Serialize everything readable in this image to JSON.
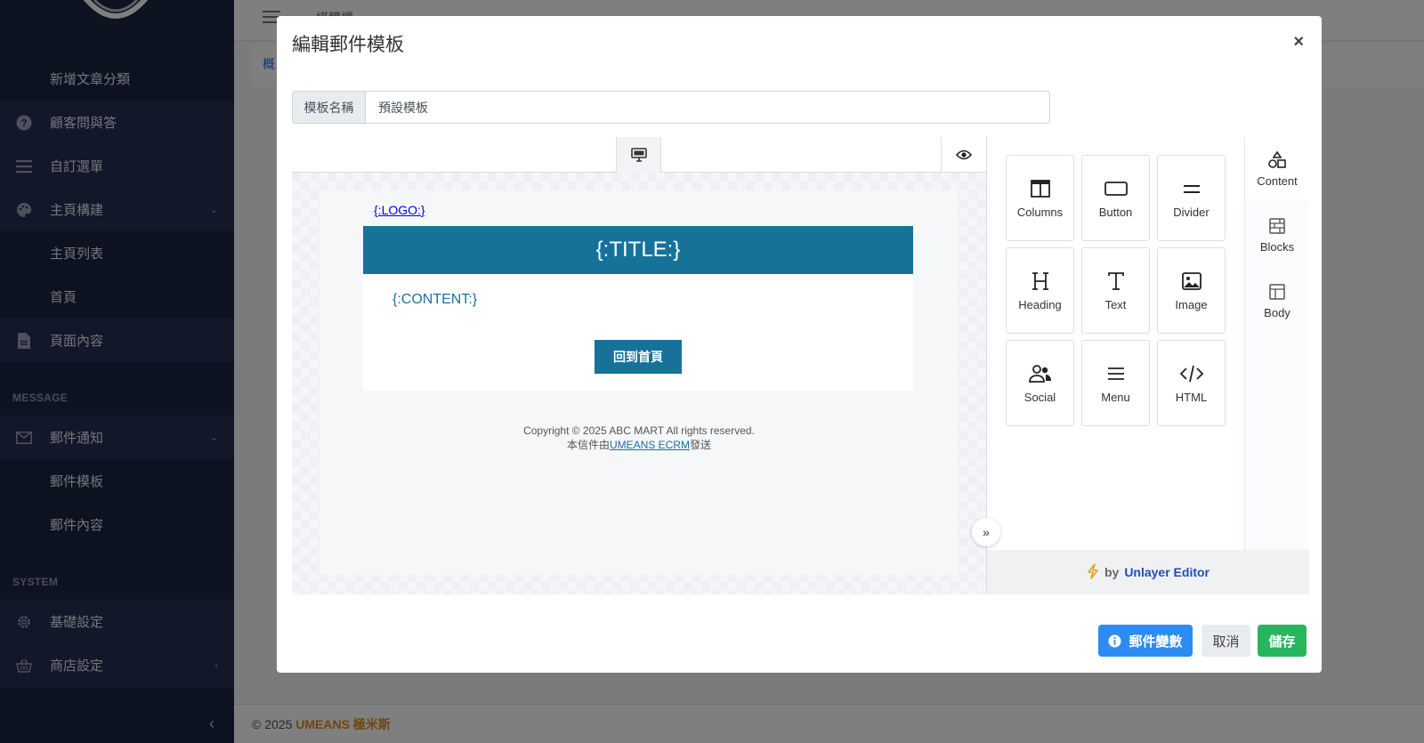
{
  "sidebar": {
    "items": [
      {
        "label": "新增文章分類",
        "icon": "",
        "type": "sub"
      },
      {
        "label": "顧客問與答",
        "icon": "question-circle-icon"
      },
      {
        "label": "自訂選單",
        "icon": "list-icon"
      },
      {
        "label": "主頁構建",
        "icon": "palette-icon",
        "chevron": "⌄"
      },
      {
        "label": "主頁列表",
        "icon": "",
        "type": "sub"
      },
      {
        "label": "首頁",
        "icon": "",
        "type": "sub"
      },
      {
        "label": "頁面內容",
        "icon": "file-icon"
      },
      {
        "label": "郵件通知",
        "icon": "envelope-icon",
        "chevron": "⌄"
      },
      {
        "label": "郵件模板",
        "icon": "",
        "type": "sub"
      },
      {
        "label": "郵件內容",
        "icon": "",
        "type": "sub"
      },
      {
        "label": "基礎設定",
        "icon": "gear-icon"
      },
      {
        "label": "商店設定",
        "icon": "basket-icon",
        "chevron": "‹"
      }
    ],
    "headers": {
      "message": "MESSAGE",
      "system": "SYSTEM"
    }
  },
  "topbar": {
    "breadcrumb": "媒體櫃"
  },
  "content": {
    "tab": "概"
  },
  "footer": {
    "copyright": "© 2025 ",
    "brand": "UMEANS 極米斯"
  },
  "modal": {
    "title": "編輯郵件模板",
    "close": "×",
    "name_label": "模板名稱",
    "name_value": "預設模板",
    "email": {
      "logo": "{:LOGO:}",
      "title": "{:TITLE:}",
      "content": "{:CONTENT:}",
      "button": "回到首頁",
      "footer_line1": "Copyright © 2025 ABC MART All rights reserved.",
      "footer_line2_prefix": "本信件由",
      "footer_line2_link": "UMEANS ECRM",
      "footer_line2_suffix": "發送"
    },
    "tools": [
      {
        "label": "Columns",
        "icon": "columns-icon"
      },
      {
        "label": "Button",
        "icon": "button-icon"
      },
      {
        "label": "Divider",
        "icon": "divider-icon"
      },
      {
        "label": "Heading",
        "icon": "heading-icon"
      },
      {
        "label": "Text",
        "icon": "text-icon"
      },
      {
        "label": "Image",
        "icon": "image-icon"
      },
      {
        "label": "Social",
        "icon": "social-icon"
      },
      {
        "label": "Menu",
        "icon": "menu-icon"
      },
      {
        "label": "HTML",
        "icon": "code-icon"
      }
    ],
    "tabs": [
      {
        "label": "Content",
        "icon": "shapes-icon"
      },
      {
        "label": "Blocks",
        "icon": "blocks-icon"
      },
      {
        "label": "Body",
        "icon": "body-icon"
      }
    ],
    "powered_by": {
      "by": "by",
      "name": "Unlayer Editor"
    },
    "buttons": {
      "vars": "郵件變數",
      "cancel": "取消",
      "save": "儲存"
    }
  },
  "colors": {
    "sidebar_bg": "#1c2742",
    "email_header": "#17729a",
    "primary": "#2c8cf4",
    "success": "#28b55d",
    "brand": "#e08a1e"
  }
}
